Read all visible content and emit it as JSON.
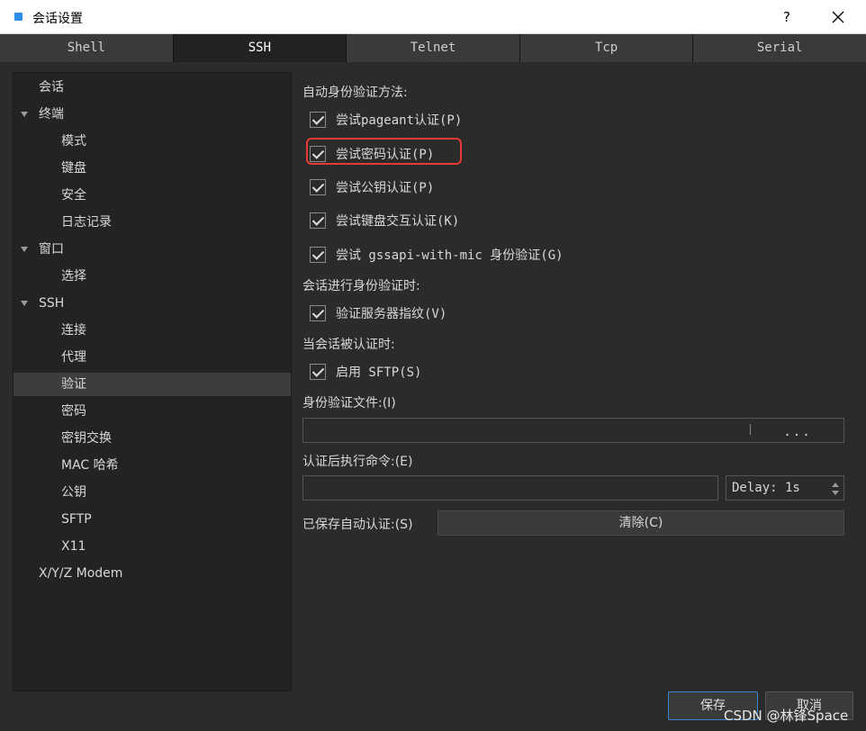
{
  "window": {
    "title": "会话设置",
    "help_label": "?",
    "accent_color": "#2d8ee6"
  },
  "tabs": [
    {
      "label": "Shell",
      "active": false
    },
    {
      "label": "SSH",
      "active": true
    },
    {
      "label": "Telnet",
      "active": false
    },
    {
      "label": "Tcp",
      "active": false
    },
    {
      "label": "Serial",
      "active": false
    }
  ],
  "sidebar": {
    "items": [
      {
        "label": "会话",
        "level": 1,
        "expandable": false
      },
      {
        "label": "终端",
        "level": 1,
        "expandable": true
      },
      {
        "label": "模式",
        "level": 2
      },
      {
        "label": "键盘",
        "level": 2
      },
      {
        "label": "安全",
        "level": 2
      },
      {
        "label": "日志记录",
        "level": 2
      },
      {
        "label": "窗口",
        "level": 1,
        "expandable": true
      },
      {
        "label": "选择",
        "level": 2
      },
      {
        "label": "SSH",
        "level": 1,
        "expandable": true
      },
      {
        "label": "连接",
        "level": 2
      },
      {
        "label": "代理",
        "level": 2
      },
      {
        "label": "验证",
        "level": 2,
        "selected": true
      },
      {
        "label": "密码",
        "level": 2
      },
      {
        "label": "密钥交换",
        "level": 2
      },
      {
        "label": "MAC 哈希",
        "level": 2
      },
      {
        "label": "公钥",
        "level": 2
      },
      {
        "label": "SFTP",
        "level": 2
      },
      {
        "label": "X11",
        "level": 2
      },
      {
        "label": "X/Y/Z Modem",
        "level": 1,
        "expandable": false
      }
    ]
  },
  "auth": {
    "methods_label": "自动身份验证方法:",
    "methods": [
      {
        "label": "尝试pageant认证(P)",
        "checked": true
      },
      {
        "label": "尝试密码认证(P)",
        "checked": true,
        "highlighted": true
      },
      {
        "label": "尝试公钥认证(P)",
        "checked": true
      },
      {
        "label": "尝试键盘交互认证(K)",
        "checked": true
      },
      {
        "label": "尝试 gssapi-with-mic 身份验证(G)",
        "checked": true
      }
    ],
    "during_label": "会话进行身份验证时:",
    "verify_fingerprint": {
      "label": "验证服务器指纹(V)",
      "checked": true
    },
    "after_label": "当会话被认证时:",
    "enable_sftp": {
      "label": "启用 SFTP(S)",
      "checked": true
    },
    "identity_file_label": "身份验证文件:(I)",
    "identity_file_value": "",
    "browse_label": "...",
    "post_cmd_label": "认证后执行命令:(E)",
    "post_cmd_value": "",
    "delay_value": "Delay: 1s",
    "saved_auth_label": "已保存自动认证:(S)",
    "clear_label": "清除(C)"
  },
  "footer": {
    "ok_label": "保存",
    "cancel_label": "取消"
  },
  "watermark": "CSDN @林锋Space"
}
